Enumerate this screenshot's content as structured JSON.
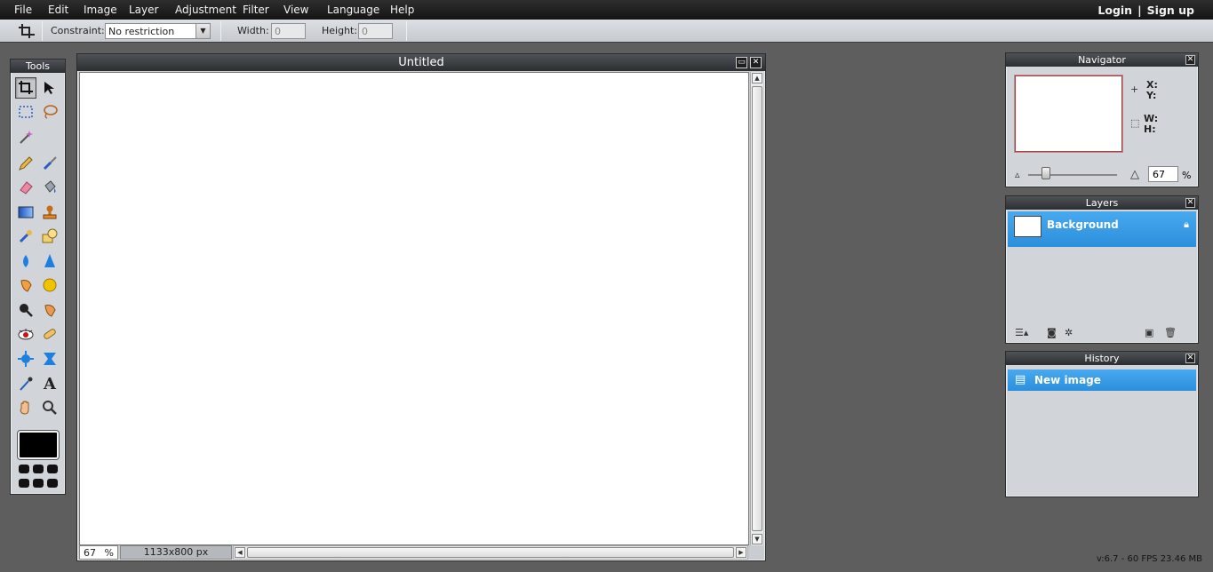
{
  "menu": {
    "items": [
      "File",
      "Edit",
      "Image",
      "Layer",
      "Adjustment",
      "Filter",
      "View",
      "Language",
      "Help"
    ],
    "login": "Login",
    "separator": "|",
    "signup": "Sign up"
  },
  "options": {
    "constraint_label": "Constraint:",
    "constraint_value": "No restriction",
    "width_label": "Width:",
    "width_value": "0",
    "height_label": "Height:",
    "height_value": "0"
  },
  "tools": {
    "title": "Tools",
    "items": [
      "crop-icon",
      "move-icon",
      "marquee-icon",
      "lasso-icon",
      "magic-wand-icon",
      "pencil-icon",
      "brush-icon",
      "eraser-icon",
      "paint-bucket-icon",
      "gradient-icon",
      "clone-stamp-icon",
      "color-replace-icon",
      "shape-icon",
      "blur-icon",
      "sharpen-icon",
      "smudge-icon",
      "sponge-icon",
      "dodge-icon",
      "burn-icon",
      "red-eye-icon",
      "spot-heal-icon",
      "bloat-icon",
      "pinch-icon",
      "color-picker-icon",
      "text-icon",
      "hand-icon",
      "zoom-icon"
    ],
    "foreground_color": "#000000"
  },
  "document": {
    "title": "Untitled",
    "zoom": "67",
    "zoom_unit": "%",
    "size": "1133x800 px"
  },
  "navigator": {
    "title": "Navigator",
    "x_label": "X:",
    "y_label": "Y:",
    "w_label": "W:",
    "h_label": "H:",
    "zoom": "67",
    "zoom_unit": "%"
  },
  "layers": {
    "title": "Layers",
    "items": [
      {
        "name": "Background"
      }
    ]
  },
  "history": {
    "title": "History",
    "items": [
      {
        "name": "New image"
      }
    ]
  },
  "status": {
    "version": "v:6.7 - 60 FPS 23.46 MB"
  },
  "colors": {
    "accent": "#2b8fdc",
    "background": "#5e5e5e",
    "panel": "#d1d4d8"
  }
}
